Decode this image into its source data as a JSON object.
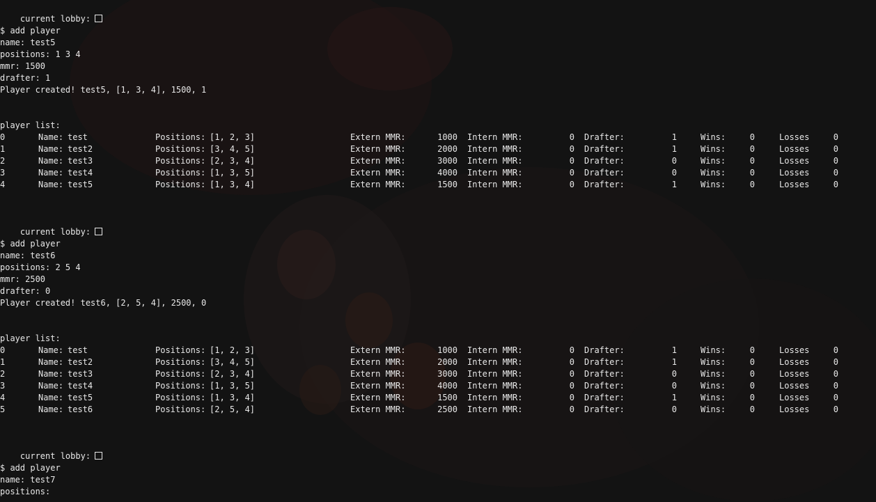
{
  "terminal": {
    "lobby_label": "current lobby:",
    "cmd_add_player": "$ add player",
    "player_list_label": "player list:",
    "col_name": "Name:",
    "col_positions": "Positions:",
    "col_extern": "Extern MMR:",
    "col_intern": "Intern MMR:",
    "col_drafter": "Drafter:",
    "col_wins": "Wins:",
    "col_losses": "Losses",
    "block1": {
      "name_line": "name: test5",
      "positions_line": "positions: 1 3 4",
      "mmr_line": "mmr: 1500",
      "drafter_line": "drafter: 1",
      "created_line": "Player created! test5, [1, 3, 4], 1500, 1"
    },
    "block2": {
      "name_line": "name: test6",
      "positions_line": "positions: 2 5 4",
      "mmr_line": "mmr: 2500",
      "drafter_line": "drafter: 0",
      "created_line": "Player created! test6, [2, 5, 4], 2500, 0"
    },
    "block3": {
      "name_line": "name: test7",
      "positions_line": "positions:"
    },
    "list1": [
      {
        "idx": "0",
        "name": "test",
        "positions": "[1, 2, 3]",
        "extern": "1000",
        "intern": "0",
        "drafter": "1",
        "wins": "0",
        "losses": "0"
      },
      {
        "idx": "1",
        "name": "test2",
        "positions": "[3, 4, 5]",
        "extern": "2000",
        "intern": "0",
        "drafter": "1",
        "wins": "0",
        "losses": "0"
      },
      {
        "idx": "2",
        "name": "test3",
        "positions": "[2, 3, 4]",
        "extern": "3000",
        "intern": "0",
        "drafter": "0",
        "wins": "0",
        "losses": "0"
      },
      {
        "idx": "3",
        "name": "test4",
        "positions": "[1, 3, 5]",
        "extern": "4000",
        "intern": "0",
        "drafter": "0",
        "wins": "0",
        "losses": "0"
      },
      {
        "idx": "4",
        "name": "test5",
        "positions": "[1, 3, 4]",
        "extern": "1500",
        "intern": "0",
        "drafter": "1",
        "wins": "0",
        "losses": "0"
      }
    ],
    "list2": [
      {
        "idx": "0",
        "name": "test",
        "positions": "[1, 2, 3]",
        "extern": "1000",
        "intern": "0",
        "drafter": "1",
        "wins": "0",
        "losses": "0"
      },
      {
        "idx": "1",
        "name": "test2",
        "positions": "[3, 4, 5]",
        "extern": "2000",
        "intern": "0",
        "drafter": "1",
        "wins": "0",
        "losses": "0"
      },
      {
        "idx": "2",
        "name": "test3",
        "positions": "[2, 3, 4]",
        "extern": "3000",
        "intern": "0",
        "drafter": "0",
        "wins": "0",
        "losses": "0"
      },
      {
        "idx": "3",
        "name": "test4",
        "positions": "[1, 3, 5]",
        "extern": "4000",
        "intern": "0",
        "drafter": "0",
        "wins": "0",
        "losses": "0"
      },
      {
        "idx": "4",
        "name": "test5",
        "positions": "[1, 3, 4]",
        "extern": "1500",
        "intern": "0",
        "drafter": "1",
        "wins": "0",
        "losses": "0"
      },
      {
        "idx": "5",
        "name": "test6",
        "positions": "[2, 5, 4]",
        "extern": "2500",
        "intern": "0",
        "drafter": "0",
        "wins": "0",
        "losses": "0"
      }
    ]
  }
}
